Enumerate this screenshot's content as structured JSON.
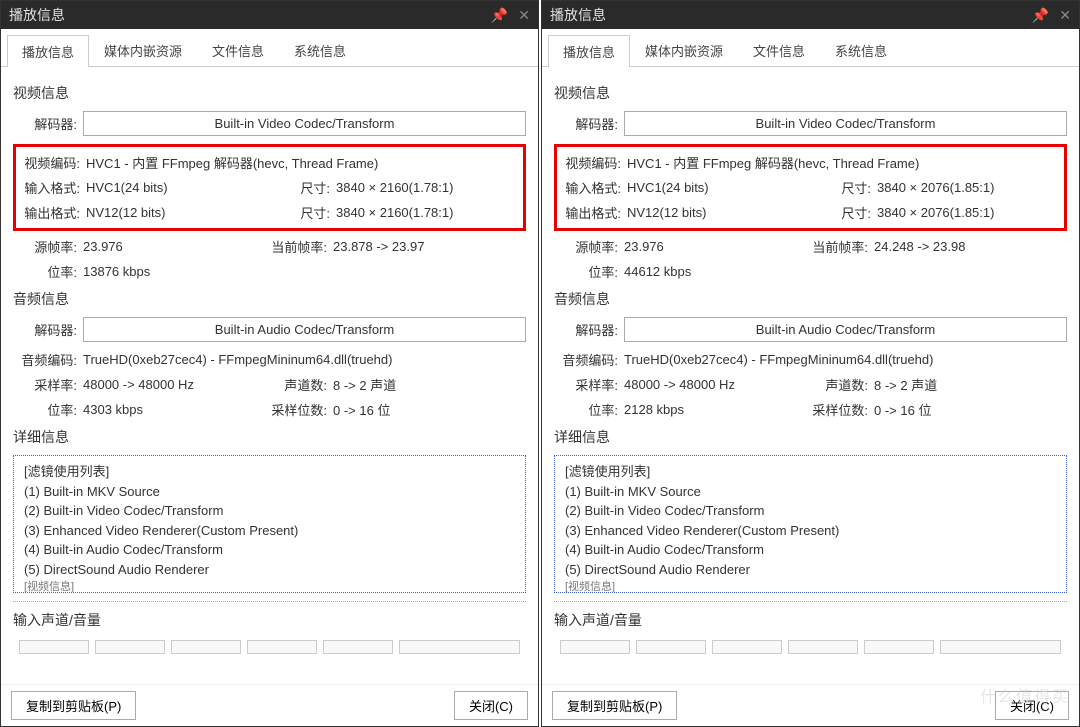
{
  "window_title": "播放信息",
  "tabs": [
    "播放信息",
    "媒体内嵌资源",
    "文件信息",
    "系统信息"
  ],
  "section_video": "视频信息",
  "section_audio": "音频信息",
  "section_detail": "详细信息",
  "section_channel": "输入声道/音量",
  "label_decoder": "解码器",
  "label_video_codec": "视频编码",
  "label_input_fmt": "输入格式",
  "label_output_fmt": "输出格式",
  "label_size": "尺寸",
  "label_src_fps": "源帧率",
  "label_cur_fps": "当前帧率",
  "label_bitrate": "位率",
  "label_audio_codec": "音频编码",
  "label_sample": "采样率",
  "label_channels": "声道数",
  "label_sample_bits": "采样位数",
  "video_decoder_btn": "Built-in Video Codec/Transform",
  "audio_decoder_btn": "Built-in Audio Codec/Transform",
  "filter_header": "[滤镜使用列表]",
  "filter_lines": [
    "(1) Built-in MKV Source",
    "(2) Built-in Video Codec/Transform",
    "(3) Enhanced Video Renderer(Custom Present)",
    "(4) Built-in Audio Codec/Transform",
    "(5) DirectSound Audio Renderer"
  ],
  "filter_cut": "[视频信息]",
  "footer_copy": "复制到剪贴板(P)",
  "footer_close": "关闭(C)",
  "watermark": "什么值得买",
  "left": {
    "video_codec": "HVC1 - 内置 FFmpeg 解码器(hevc, Thread Frame)",
    "in_fmt": "HVC1(24 bits)",
    "in_size": "3840 × 2160(1.78:1)",
    "out_fmt": "NV12(12 bits)",
    "out_size": "3840 × 2160(1.78:1)",
    "src_fps": "23.976",
    "cur_fps": "23.878 -> 23.97",
    "v_bitrate": "13876 kbps",
    "audio_codec": "TrueHD(0xeb27cec4) - FFmpegMininum64.dll(truehd)",
    "sample": "48000 -> 48000 Hz",
    "channels": "8 -> 2 声道",
    "a_bitrate": "4303 kbps",
    "sample_bits": "0 -> 16 位"
  },
  "right": {
    "video_codec": "HVC1 - 内置 FFmpeg 解码器(hevc, Thread Frame)",
    "in_fmt": "HVC1(24 bits)",
    "in_size": "3840 × 2076(1.85:1)",
    "out_fmt": "NV12(12 bits)",
    "out_size": "3840 × 2076(1.85:1)",
    "src_fps": "23.976",
    "cur_fps": "24.248 -> 23.98",
    "v_bitrate": "44612 kbps",
    "audio_codec": "TrueHD(0xeb27cec4) - FFmpegMininum64.dll(truehd)",
    "sample": "48000 -> 48000 Hz",
    "channels": "8 -> 2 声道",
    "a_bitrate": "2128 kbps",
    "sample_bits": "0 -> 16 位"
  }
}
